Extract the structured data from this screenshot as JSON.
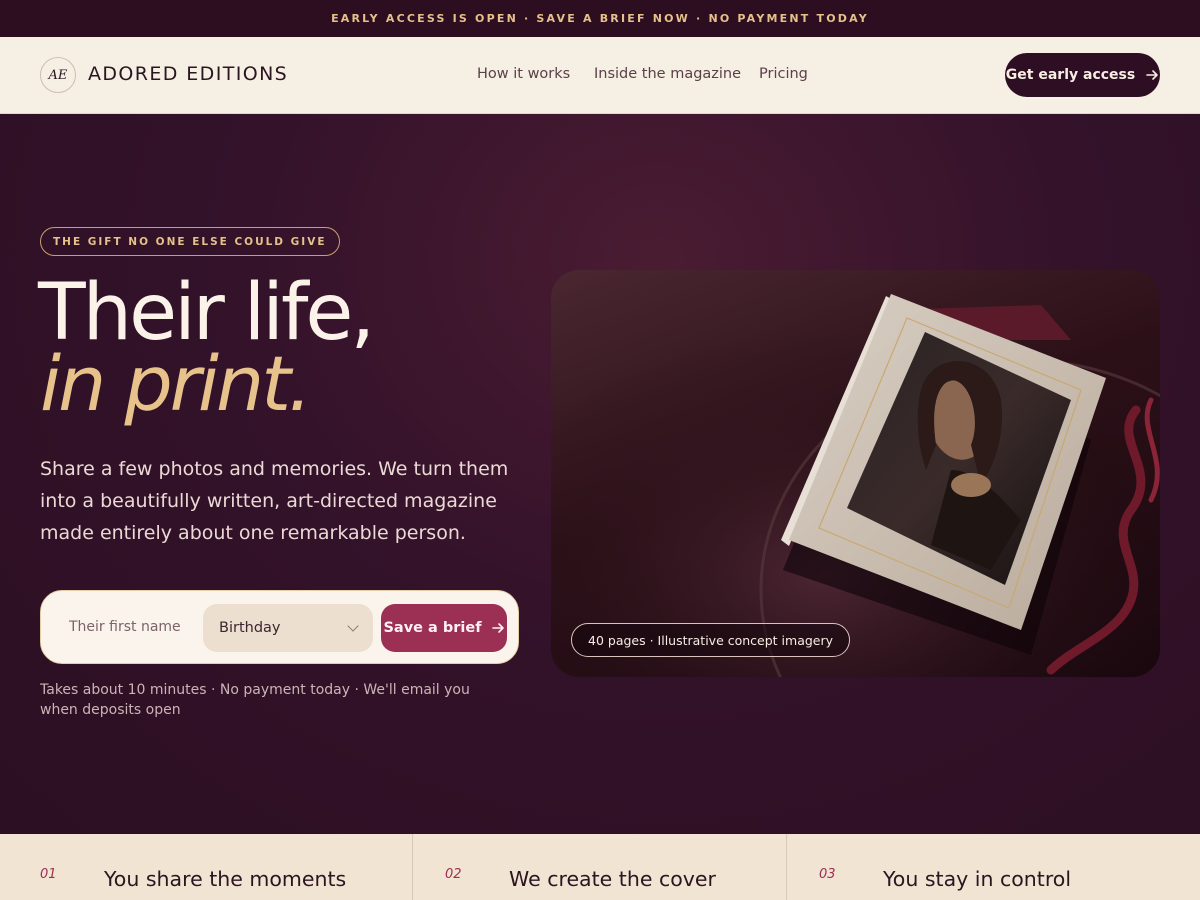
{
  "announcement": "EARLY ACCESS IS OPEN · SAVE A BRIEF NOW · NO PAYMENT TODAY",
  "brand": {
    "mark": "AE",
    "name": "ADORED EDITIONS"
  },
  "nav": {
    "links": [
      "How it works",
      "Inside the magazine",
      "Pricing"
    ],
    "cta": "Get early access"
  },
  "hero": {
    "eyebrow": "THE GIFT NO ONE ELSE COULD GIVE",
    "headline_line1": "Their life,",
    "headline_line2": "in print.",
    "description": "Share a few photos and memories. We turn them into a beautifully written, art-directed magazine made entirely about one remarkable person.",
    "form": {
      "name_placeholder": "Their first name",
      "occasion_selected": "Birthday",
      "submit_label": "Save a brief"
    },
    "note": "Takes about 10 minutes · No payment today · We'll email you when deposits open",
    "image_badge": "40 pages · Illustrative concept imagery"
  },
  "steps": [
    {
      "number": "01",
      "title": "You share the moments"
    },
    {
      "number": "02",
      "title": "We create the cover"
    },
    {
      "number": "03",
      "title": "You stay in control"
    }
  ],
  "colors": {
    "accent_gold": "#e7c38b",
    "accent_berry": "#9b2f54",
    "background_plum": "#2e1121",
    "cream": "#f6efe4"
  }
}
